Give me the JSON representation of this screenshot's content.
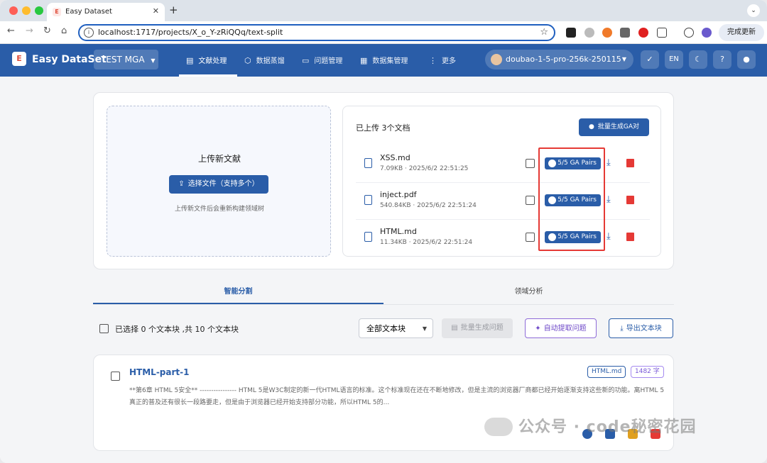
{
  "browser": {
    "tab_title": "Easy Dataset",
    "url": "localhost:1717/projects/X_o_Y-zRiQQq/text-split",
    "update_label": "完成更新"
  },
  "app": {
    "brand": "Easy DataSet",
    "project": "TEST MGA",
    "nav": [
      {
        "label": "文献处理"
      },
      {
        "label": "数据蒸馏"
      },
      {
        "label": "问题管理"
      },
      {
        "label": "数据集管理"
      },
      {
        "label": "更多"
      }
    ],
    "model": "doubao-1-5-pro-256k-250115",
    "lang": "EN"
  },
  "upload": {
    "title": "上传新文献",
    "button": "选择文件（支持多个）",
    "hint": "上传新文件后会重新构建领域树"
  },
  "docs": {
    "header": "已上传 3个文档",
    "batch_button": "批量生成GA对",
    "items": [
      {
        "name": "XSS.md",
        "meta": "7.09KB · 2025/6/2 22:51:25",
        "ga": "5/5 GA Pairs"
      },
      {
        "name": "inject.pdf",
        "meta": "540.84KB · 2025/6/2 22:51:24",
        "ga": "5/5 GA Pairs"
      },
      {
        "name": "HTML.md",
        "meta": "11.34KB · 2025/6/2 22:51:24",
        "ga": "5/5 GA Pairs"
      }
    ]
  },
  "tabs": {
    "smart_split": "智能分割",
    "domain": "领域分析"
  },
  "actions": {
    "selection": "已选择 0 个文本块 ,共 10 个文本块",
    "filter": "全部文本块",
    "batch_q": "批量生成问题",
    "auto_q": "自动提取问题",
    "export": "导出文本块"
  },
  "chunk": {
    "title": "HTML-part-1",
    "tag_file": "HTML.md",
    "tag_chars": "1482 字",
    "text": "**第6章 HTML 5安全** ---------------- HTML 5是W3C制定的新一代HTML语言的标准。这个标准现在还在不断地修改，但是主流的浏览器厂商都已经开始逐渐支持这些新的功能。离HTML 5真正的普及还有很长一段路要走，但是由于浏览器已经开始支持部分功能，所以HTML 5的..."
  },
  "watermark": "公众号 · code秘密花园",
  "colors": {
    "primary": "#2a5da8",
    "danger": "#e53935",
    "highlight": "#e53935"
  }
}
